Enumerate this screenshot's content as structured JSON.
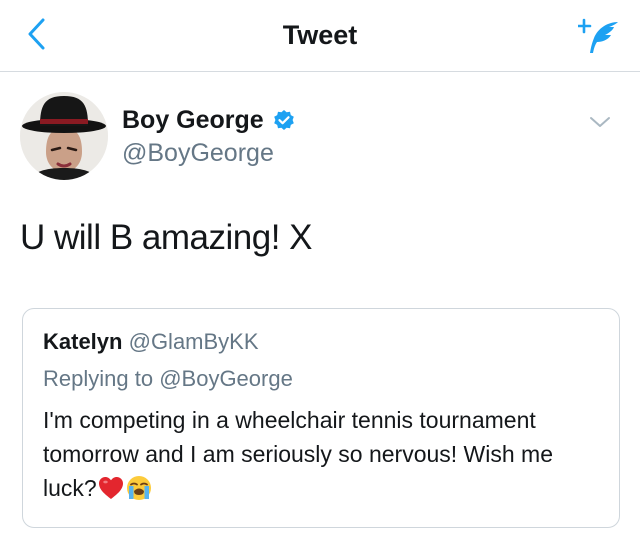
{
  "nav": {
    "title": "Tweet",
    "back_icon": "chevron-left-icon",
    "compose_icon": "compose-feather-icon",
    "accent": "#1da1f2"
  },
  "tweet": {
    "author": {
      "name": "Boy George",
      "handle": "@BoyGeorge",
      "verified": true,
      "verified_icon": "verified-badge-icon"
    },
    "text": "U will B amazing! X",
    "menu_icon": "chevron-down-icon"
  },
  "quoted": {
    "author_name": "Katelyn",
    "author_handle": "@GlamByKK",
    "reply_prefix": "Replying to",
    "reply_handle": "@BoyGeorge",
    "text": "I'm competing in a wheelchair tennis tournament tomorrow and I am seriously so nervous! Wish me luck?",
    "emojis": [
      "red-heart-emoji",
      "crying-face-emoji"
    ]
  },
  "colors": {
    "text": "#14171a",
    "secondary": "#657786",
    "divider": "#d6dbe0"
  }
}
